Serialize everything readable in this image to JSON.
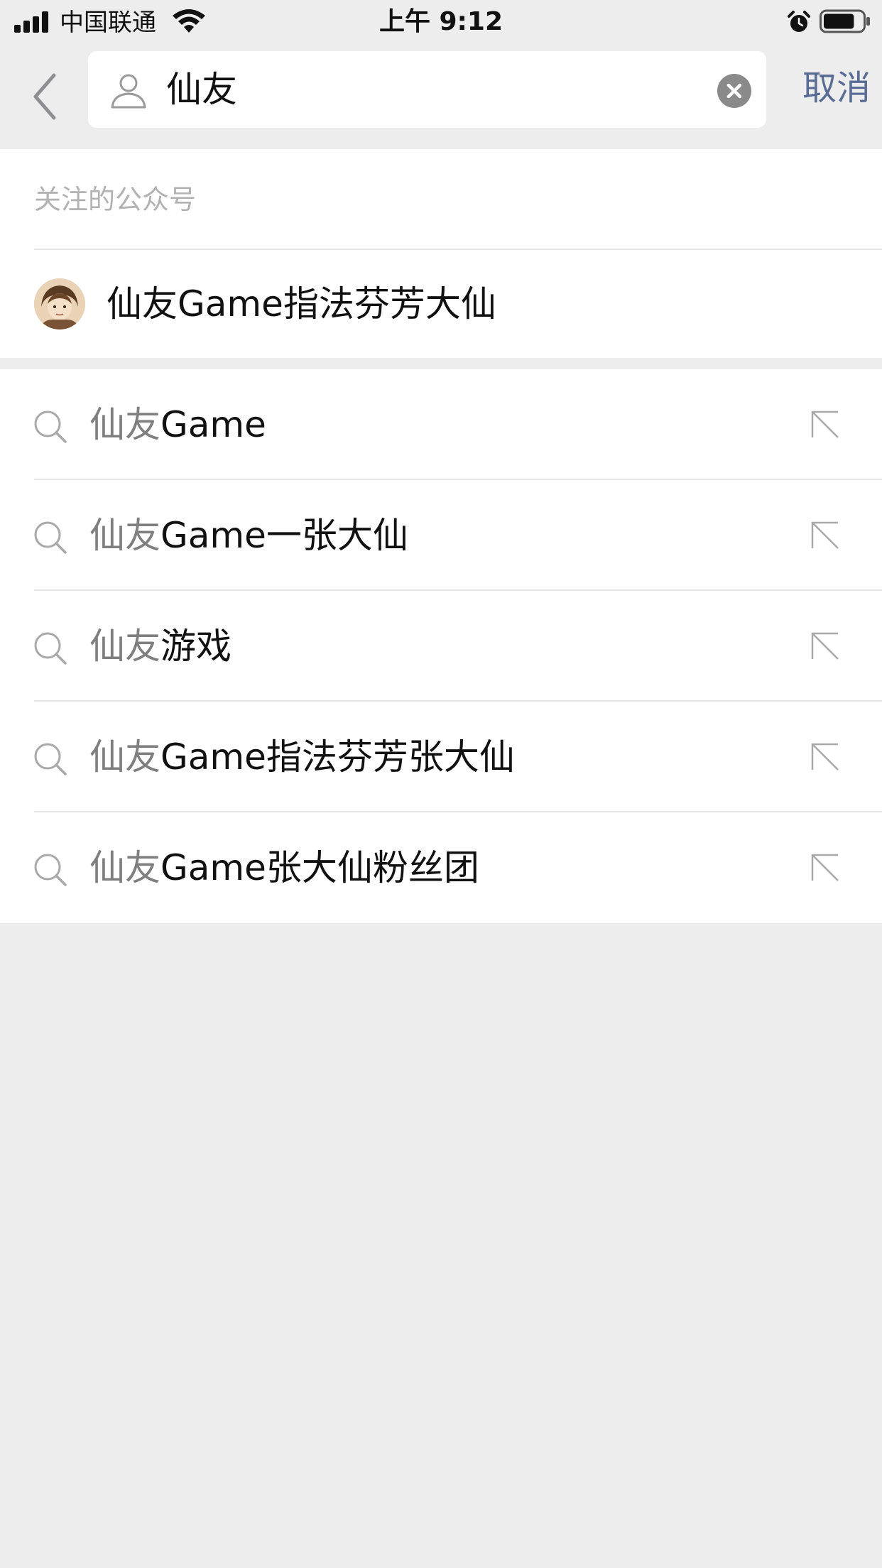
{
  "status_bar": {
    "carrier": "中国联通",
    "time": "上午 9:12",
    "battery_level": 0.8
  },
  "search": {
    "query": "仙友",
    "cancel_label": "取消"
  },
  "followed_accounts": {
    "header": "关注的公众号",
    "items": [
      {
        "name": "仙友Game指法芬芳大仙"
      }
    ]
  },
  "suggestions": [
    {
      "prefix": "仙友",
      "rest": "Game"
    },
    {
      "prefix": "仙友",
      "rest": "Game一张大仙"
    },
    {
      "prefix": "仙友",
      "rest": "游戏"
    },
    {
      "prefix": "仙友",
      "rest": "Game指法芬芳张大仙"
    },
    {
      "prefix": "仙友",
      "rest": "Game张大仙粉丝团"
    }
  ],
  "colors": {
    "background": "#ededed",
    "link": "#576b95",
    "muted": "#b2b2b2",
    "prefix": "#7f7f7f"
  }
}
